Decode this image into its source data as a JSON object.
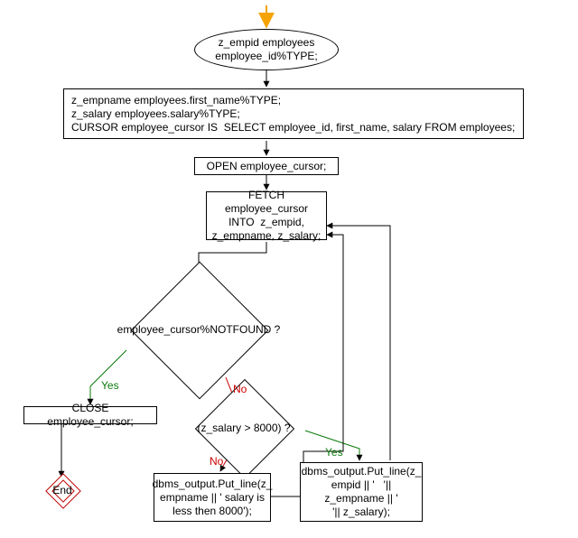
{
  "nodes": {
    "start": "z_empid employees\nemployee_id%TYPE;",
    "decls": "z_empname employees.first_name%TYPE;\nz_salary employees.salary%TYPE;\nCURSOR employee_cursor IS  SELECT employee_id, first_name, salary FROM employees;",
    "open": "OPEN employee_cursor;",
    "fetch": "FETCH employee_cursor\nINTO  z_empid,\nz_empname, z_salary;",
    "notfound": "employee_cursor%NOTFOUND\n?",
    "salarycmp": "(z_salary > 8000) ?",
    "close": "CLOSE employee_cursor;",
    "out_low": "dbms_output.Put_line(z_\nempname || ' salary is\nless then 8000');",
    "out_high": "dbms_output.Put_line(z_\nempid || '   '||\nz_empname || '\n'|| z_salary);",
    "end": "End"
  },
  "labels": {
    "yes": "Yes",
    "no": "No"
  }
}
